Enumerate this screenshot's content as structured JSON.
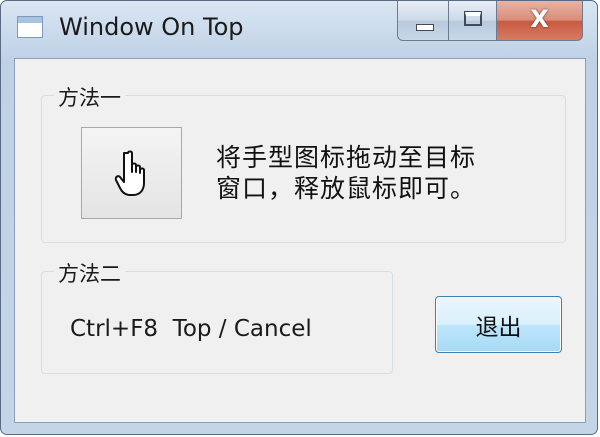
{
  "window": {
    "title": "Window On Top",
    "icons": {
      "app": "window-icon",
      "minimize": "minimize-icon",
      "maximize": "maximize-icon",
      "close": "close-icon"
    },
    "close_glyph": "X"
  },
  "method1": {
    "label": "方法一",
    "drag_icon": "hand-pointer-icon",
    "description_line1": "将手型图标拖动至目标",
    "description_line2": "窗口，释放鼠标即可。"
  },
  "method2": {
    "label": "方法二",
    "hotkey_text": "Ctrl+F8  Top / Cancel"
  },
  "buttons": {
    "exit_label": "退出"
  },
  "colors": {
    "frame": "#c4d5e8",
    "client": "#f0f0f0",
    "close_button": "#c85a40",
    "exit_button_border": "#3c7fb1"
  }
}
